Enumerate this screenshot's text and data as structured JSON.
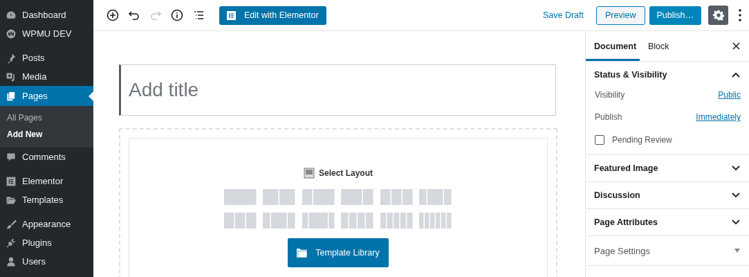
{
  "sidebar": {
    "groups": [
      {
        "items": [
          {
            "label": "Dashboard",
            "selected": false
          },
          {
            "label": "WPMU DEV",
            "selected": false
          }
        ]
      },
      {
        "items": [
          {
            "label": "Posts",
            "selected": false
          },
          {
            "label": "Media",
            "selected": false
          },
          {
            "label": "Pages",
            "selected": true,
            "children": [
              {
                "label": "All Pages",
                "selected": false
              },
              {
                "label": "Add New",
                "selected": true
              }
            ]
          },
          {
            "label": "Comments",
            "selected": false
          }
        ]
      },
      {
        "items": [
          {
            "label": "Elementor",
            "selected": false
          },
          {
            "label": "Templates",
            "selected": false
          }
        ]
      },
      {
        "items": [
          {
            "label": "Appearance",
            "selected": false
          },
          {
            "label": "Plugins",
            "selected": false
          },
          {
            "label": "Users",
            "selected": false
          }
        ]
      }
    ]
  },
  "toolbar": {
    "tools": [
      {
        "disabled": false
      },
      {
        "disabled": false
      },
      {
        "disabled": true
      },
      {
        "disabled": false
      },
      {
        "disabled": false
      }
    ],
    "elementor_button": "Edit with Elementor",
    "save_draft": "Save Draft",
    "preview": "Preview",
    "publish": "Publish…",
    "settings_selected": true
  },
  "editor": {
    "title_placeholder": "Add title",
    "layout_heading": "Select Layout",
    "template_button": "Template Library"
  },
  "panel": {
    "tabs": [
      {
        "label": "Document",
        "selected": true
      },
      {
        "label": "Block",
        "selected": false
      }
    ],
    "sections": [
      {
        "title": "Status & Visibility",
        "kind": "panel",
        "expanded": true,
        "rows": [
          {
            "label": "Visibility",
            "value": "Public"
          },
          {
            "label": "Publish",
            "value": "Immediately"
          }
        ],
        "checkbox": {
          "label": "Pending Review",
          "checked": false
        }
      },
      {
        "title": "Featured Image",
        "kind": "panel",
        "expanded": false
      },
      {
        "title": "Discussion",
        "kind": "panel",
        "expanded": false
      },
      {
        "title": "Page Attributes",
        "kind": "panel",
        "expanded": false
      },
      {
        "title": "Page Settings",
        "kind": "metabox",
        "expanded": false
      }
    ]
  }
}
